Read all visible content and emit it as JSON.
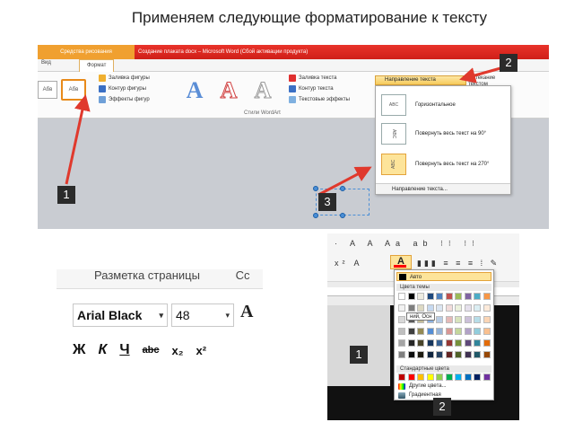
{
  "title": "Применяем следующие форматирование к тексту",
  "panel1": {
    "contextual_tab": "Средства рисования",
    "window_title": "Создание плаката docx – Microsoft Word (Сбой активации продукта)",
    "tabs": [
      "Вид",
      "Формат"
    ],
    "shape_fill": "Заливка фигуры",
    "shape_outline": "Контур фигуры",
    "shape_effects": "Эффекты фигур",
    "text_fill": "Заливка текста",
    "text_outline": "Контур текста",
    "text_effects": "Текстовые эффекты",
    "wordart_styles_label": "Стили WordArt",
    "shape_btn_label": "Абв",
    "text_direction": "Направление текста",
    "dropdown": [
      {
        "icon": "ABC",
        "label": "Горизонтальное"
      },
      {
        "icon": "ABC",
        "label": "Повернуть весь текст на 90°"
      },
      {
        "icon": "ABC",
        "label": "Повернуть весь текст на 270°"
      }
    ],
    "dropdown_footer": "Направление текста...",
    "right_items": [
      "Обтекание",
      "текстом"
    ],
    "badges": [
      "1",
      "2",
      "3"
    ]
  },
  "panel2": {
    "menu": [
      "",
      "Разметка страницы",
      "",
      "Сс"
    ],
    "font_name": "Arial Black",
    "font_size": "48",
    "grow_icon": "A",
    "format_buttons": [
      "Ж",
      "К",
      "Ч",
      "abc",
      "x₂",
      "x²"
    ]
  },
  "panel3": {
    "auto_label": "Авто",
    "theme_colors_label": "Цвета темы",
    "standard_colors_label": "Стандартные цвета",
    "more_colors": "Другие цвета...",
    "gradient": "Градиентная",
    "tooltip": "ний, Осн",
    "badges": [
      "1",
      "2"
    ],
    "theme_top": [
      "#ffffff",
      "#000000",
      "#eeece1",
      "#1f497d",
      "#4f81bd",
      "#c0504d",
      "#9bbb59",
      "#8064a2",
      "#4bacc6",
      "#f79646"
    ],
    "theme_shades": [
      [
        "#f2f2f2",
        "#7f7f7f",
        "#ddd9c3",
        "#c6d9f0",
        "#dbe5f1",
        "#f2dcdb",
        "#ebf1dd",
        "#e5e0ec",
        "#dbeef3",
        "#fdeada"
      ],
      [
        "#d8d8d8",
        "#595959",
        "#c4bd97",
        "#8db3e2",
        "#b8cce4",
        "#e5b9b7",
        "#d7e3bc",
        "#ccc1d9",
        "#b7dde8",
        "#fbd5b5"
      ],
      [
        "#bfbfbf",
        "#3f3f3f",
        "#938953",
        "#548dd4",
        "#95b3d7",
        "#d99694",
        "#c3d69b",
        "#b2a2c7",
        "#92cddc",
        "#fac08f"
      ],
      [
        "#a5a5a5",
        "#262626",
        "#494429",
        "#17365d",
        "#366092",
        "#953734",
        "#76923c",
        "#5f497a",
        "#31859b",
        "#e36c09"
      ],
      [
        "#7f7f7f",
        "#0c0c0c",
        "#1d1b10",
        "#0f243e",
        "#244061",
        "#632423",
        "#4f6128",
        "#3f3151",
        "#205867",
        "#974806"
      ]
    ],
    "standard": [
      "#c00000",
      "#ff0000",
      "#ffc000",
      "#ffff00",
      "#92d050",
      "#00b050",
      "#00b0f0",
      "#0070c0",
      "#002060",
      "#7030a0"
    ]
  }
}
